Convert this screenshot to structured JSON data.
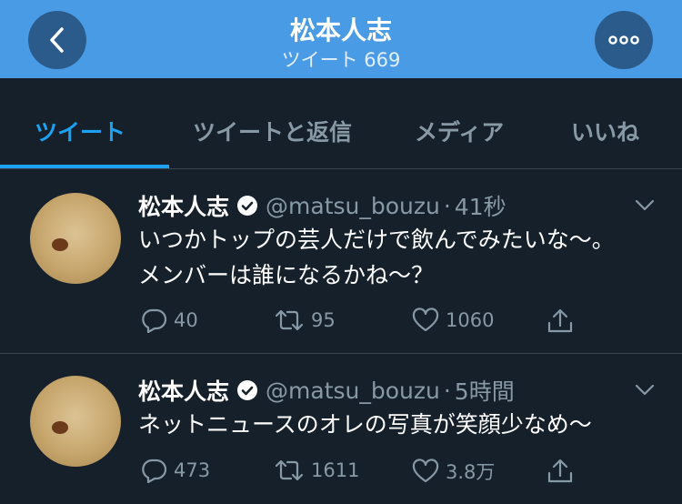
{
  "header": {
    "title": "松本人志",
    "subtitle": "ツイート 669",
    "back_icon": "chevron-left-icon",
    "more_icon": "more-horizontal-icon",
    "bg_color": "#4a9be6"
  },
  "tabs": [
    {
      "label": "ツイート",
      "active": true
    },
    {
      "label": "ツイートと返信",
      "active": false
    },
    {
      "label": "メディア",
      "active": false
    },
    {
      "label": "いいね",
      "active": false
    }
  ],
  "accent_color": "#1da1f2",
  "tweets": [
    {
      "name": "松本人志",
      "handle": "@matsu_bouzu",
      "dot": "·",
      "time": "41秒",
      "text": "いつかトップの芸人だけで飲んでみたいな〜。メンバーは誰になるかね〜？",
      "replies": "40",
      "retweets": "95",
      "likes": "1060"
    },
    {
      "name": "松本人志",
      "handle": "@matsu_bouzu",
      "dot": "·",
      "time": "5時間",
      "text": "ネットニュースのオレの写真が笑顔少なめ〜",
      "replies": "473",
      "retweets": "1611",
      "likes": "3.8万"
    }
  ]
}
